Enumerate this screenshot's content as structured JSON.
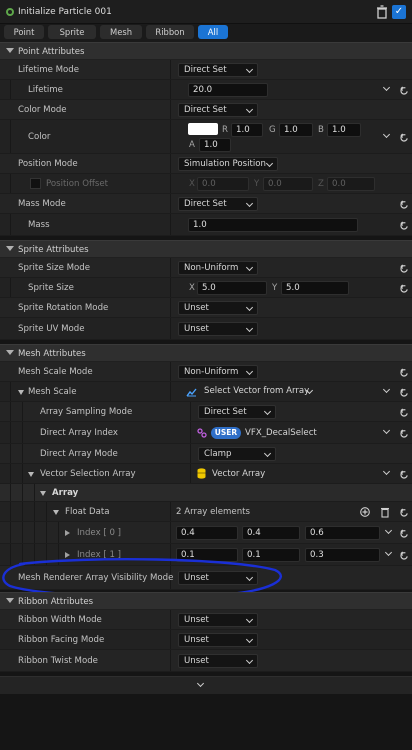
{
  "title": "Initialize Particle 001",
  "tabs": [
    {
      "label": "Point"
    },
    {
      "label": "Sprite"
    },
    {
      "label": "Mesh"
    },
    {
      "label": "Ribbon"
    },
    {
      "label": "All"
    }
  ],
  "sections": {
    "point": "Point Attributes",
    "sprite": "Sprite Attributes",
    "mesh": "Mesh Attributes",
    "ribbon": "Ribbon Attributes"
  },
  "point": {
    "lifetime_mode": {
      "label": "Lifetime Mode",
      "value": "Direct Set"
    },
    "lifetime": {
      "label": "Lifetime",
      "value": "20.0"
    },
    "color_mode": {
      "label": "Color Mode",
      "value": "Direct Set"
    },
    "color": {
      "label": "Color",
      "r_axis": "R",
      "r": "1.0",
      "g_axis": "G",
      "g": "1.0",
      "b_axis": "B",
      "b": "1.0",
      "a_axis": "A",
      "a": "1.0"
    },
    "position_mode": {
      "label": "Position Mode",
      "value": "Simulation Position"
    },
    "position_offset": {
      "label": "Position Offset",
      "x_axis": "X",
      "x": "0.0",
      "y_axis": "Y",
      "y": "0.0",
      "z_axis": "Z",
      "z": "0.0"
    },
    "mass_mode": {
      "label": "Mass Mode",
      "value": "Direct Set"
    },
    "mass": {
      "label": "Mass",
      "value": "1.0"
    }
  },
  "sprite": {
    "size_mode": {
      "label": "Sprite Size Mode",
      "value": "Non-Uniform"
    },
    "size": {
      "label": "Sprite Size",
      "x_axis": "X",
      "x": "5.0",
      "y_axis": "Y",
      "y": "5.0"
    },
    "rotation_mode": {
      "label": "Sprite Rotation Mode",
      "value": "Unset"
    },
    "uv_mode": {
      "label": "Sprite UV Mode",
      "value": "Unset"
    }
  },
  "mesh": {
    "scale_mode": {
      "label": "Mesh Scale Mode",
      "value": "Non-Uniform"
    },
    "scale": {
      "label": "Mesh Scale",
      "value": "Select Vector from Array"
    },
    "array_sampling_mode": {
      "label": "Array Sampling Mode",
      "value": "Direct Set"
    },
    "direct_array_index": {
      "label": "Direct Array Index",
      "badge": "USER",
      "value": "VFX_DecalSelect"
    },
    "direct_array_mode": {
      "label": "Direct Array Mode",
      "value": "Clamp"
    },
    "vector_selection_array": {
      "label": "Vector Selection Array",
      "value": "Vector Array"
    },
    "array": {
      "label": "Array"
    },
    "float_data": {
      "label": "Float Data",
      "value": "2 Array elements"
    },
    "index0": {
      "label": "Index [ 0 ]",
      "v0": "0.4",
      "v1": "0.4",
      "v2": "0.6"
    },
    "index1": {
      "label": "Index [ 1 ]",
      "v0": "0.1",
      "v1": "0.1",
      "v2": "0.3"
    },
    "renderer_visibility_mode": {
      "label": "Mesh Renderer Array Visibility Mode",
      "value": "Unset"
    }
  },
  "ribbon": {
    "width_mode": {
      "label": "Ribbon Width Mode",
      "value": "Unset"
    },
    "facing_mode": {
      "label": "Ribbon Facing Mode",
      "value": "Unset"
    },
    "twist_mode": {
      "label": "Ribbon Twist Mode",
      "value": "Unset"
    }
  },
  "colors": {
    "accent": "#1b74d4",
    "annotation": "#1a2fd6",
    "module_dot": "#5fa84b"
  }
}
